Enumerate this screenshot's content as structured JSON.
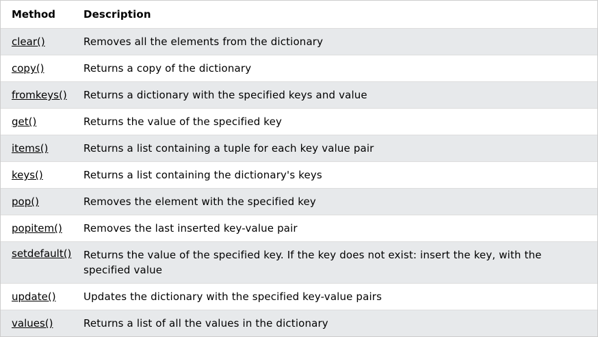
{
  "table": {
    "headers": {
      "method": "Method",
      "description": "Description"
    },
    "rows": [
      {
        "method": "clear()",
        "description": "Removes all the elements from the dictionary"
      },
      {
        "method": "copy()",
        "description": "Returns a copy of the dictionary"
      },
      {
        "method": "fromkeys()",
        "description": "Returns a dictionary with the specified keys and value"
      },
      {
        "method": "get()",
        "description": "Returns the value of the specified key"
      },
      {
        "method": "items()",
        "description": "Returns a list containing a tuple for each key value pair"
      },
      {
        "method": "keys()",
        "description": "Returns a list containing the dictionary's keys"
      },
      {
        "method": "pop()",
        "description": "Removes the element with the specified key"
      },
      {
        "method": "popitem()",
        "description": "Removes the last inserted key-value pair"
      },
      {
        "method": "setdefault()",
        "description": "Returns the value of the specified key. If the key does not exist: insert the key, with the specified value"
      },
      {
        "method": "update()",
        "description": "Updates the dictionary with the specified key-value pairs"
      },
      {
        "method": "values()",
        "description": "Returns a list of all the values in the dictionary"
      }
    ]
  }
}
